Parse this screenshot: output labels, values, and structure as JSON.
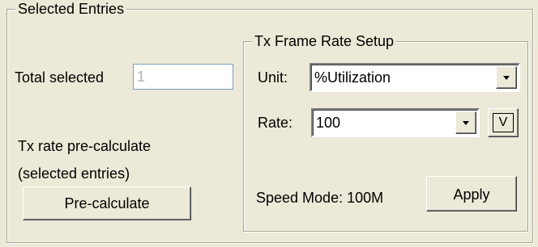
{
  "selected_entries": {
    "title": "Selected Entries",
    "total_selected_label": "Total selected",
    "total_selected_value": "1",
    "precalc_label_line1": "Tx rate pre-calculate",
    "precalc_label_line2": "(selected entries)",
    "precalc_button": "Pre-calculate"
  },
  "tx_frame_rate": {
    "title": "Tx Frame Rate Setup",
    "unit_label": "Unit:",
    "unit_value": "%Utilization",
    "rate_label": "Rate:",
    "rate_value": "100",
    "v_button": "V",
    "speed_mode": "Speed Mode: 100M",
    "apply_button": "Apply"
  }
}
